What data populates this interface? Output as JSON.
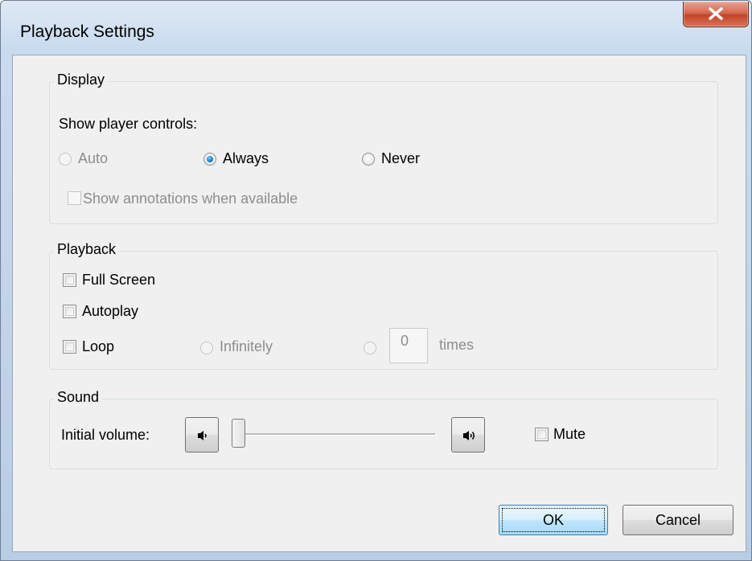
{
  "window": {
    "title": "Playback Settings"
  },
  "display": {
    "legend": "Display",
    "show_controls_label": "Show player controls:",
    "options": {
      "auto": "Auto",
      "always": "Always",
      "never": "Never"
    },
    "selected": "Always",
    "annotations_label": "Show annotations when available"
  },
  "playback": {
    "legend": "Playback",
    "full_screen": "Full Screen",
    "autoplay": "Autoplay",
    "loop": "Loop",
    "infinitely": "Infinitely",
    "loop_count": "0",
    "times": "times"
  },
  "sound": {
    "legend": "Sound",
    "volume_label": "Initial  volume:",
    "volume_level": 0,
    "mute": "Mute",
    "icons": {
      "low": "volume-low-icon",
      "high": "volume-high-icon"
    }
  },
  "buttons": {
    "ok": "OK",
    "cancel": "Cancel"
  },
  "colors": {
    "accent": "#1c7fc0",
    "close": "#c2442a",
    "disabled_text": "#8d8d8d"
  }
}
